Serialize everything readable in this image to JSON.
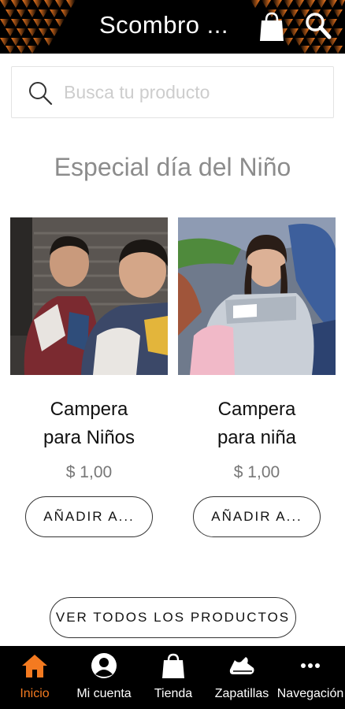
{
  "header": {
    "title": "Scombro ...",
    "bag_icon": "shopping-bag-icon",
    "search_icon": "search-icon"
  },
  "search": {
    "placeholder": "Busca tu producto",
    "value": ""
  },
  "section": {
    "title": "Especial día del Niño"
  },
  "products": [
    {
      "name_line1": "Campera",
      "name_line2": "para Niños",
      "price": "$ 1,00",
      "button": "AÑADIR A..."
    },
    {
      "name_line1": "Campera",
      "name_line2": "para niña",
      "price": "$ 1,00",
      "button": "AÑADIR A..."
    }
  ],
  "view_all": "VER TODOS LOS PRODUCTOS",
  "bottom_nav": [
    {
      "label": "Inicio",
      "icon": "home-icon",
      "active": true
    },
    {
      "label": "Mi cuenta",
      "icon": "user-icon",
      "active": false
    },
    {
      "label": "Tienda",
      "icon": "shopping-bag-icon",
      "active": false
    },
    {
      "label": "Zapatillas",
      "icon": "sneaker-icon",
      "active": false
    },
    {
      "label": "Navegación",
      "icon": "more-dots-icon",
      "active": false
    }
  ],
  "colors": {
    "accent": "#f47a20",
    "header_bg": "#000000",
    "nav_bg": "#000000",
    "section_title": "#8c8c8c"
  }
}
